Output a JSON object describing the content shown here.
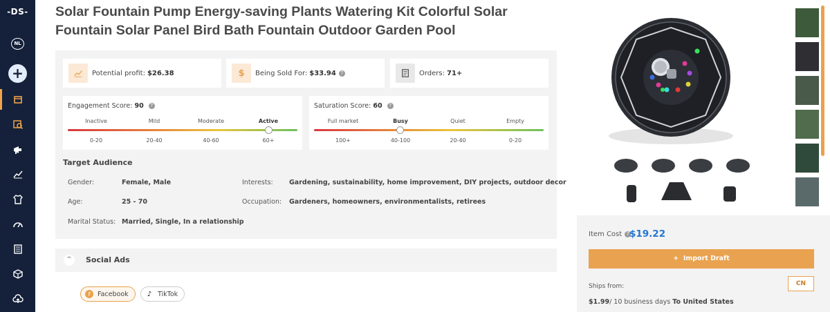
{
  "app": {
    "logo": "-DS-",
    "lang": "NL"
  },
  "sidebar": {
    "items": [
      {
        "name": "store-icon",
        "active": true
      },
      {
        "name": "product-search-icon",
        "active": false
      },
      {
        "name": "megaphone-icon",
        "active": false
      },
      {
        "name": "chart-icon",
        "active": false
      },
      {
        "name": "shirt-icon",
        "active": false
      },
      {
        "name": "gauge-icon",
        "active": false
      },
      {
        "name": "document-icon",
        "active": false
      },
      {
        "name": "box-icon",
        "active": false
      },
      {
        "name": "cloud-upload-icon",
        "active": false
      }
    ]
  },
  "product": {
    "title": "Solar Fountain Pump Energy-saving Plants Watering Kit Colorful Solar Fountain Solar Panel Bird Bath Fountain Outdoor Garden Pool"
  },
  "stats": {
    "profit_label": "Potential profit:",
    "profit_value": "$26.38",
    "sold_label": "Being Sold For:",
    "sold_value": "$33.94",
    "orders_label": "Orders:",
    "orders_value": "71+"
  },
  "engagement": {
    "label": "Engagement Score:",
    "value": "90",
    "levels": [
      "Inactive",
      "Mild",
      "Moderate",
      "Active"
    ],
    "ranges": [
      "0-20",
      "20-40",
      "40-60",
      "60+"
    ],
    "active_index": 3
  },
  "saturation": {
    "label": "Saturation Score:",
    "value": "60",
    "levels": [
      "Full market",
      "Busy",
      "Quiet",
      "Empty"
    ],
    "ranges": [
      "100+",
      "40-100",
      "20-40",
      "0-20"
    ],
    "active_index": 1
  },
  "audience": {
    "title": "Target Audience",
    "gender_label": "Gender:",
    "gender_value": "Female, Male",
    "age_label": "Age:",
    "age_value": "25 - 70",
    "marital_label": "Marital Status:",
    "marital_value": "Married, Single, In a relationship",
    "interests_label": "Interests:",
    "interests_value": "Gardening, sustainability, home improvement, DIY projects, outdoor decor",
    "occupation_label": "Occupation:",
    "occupation_value": "Gardeners, homeowners, environmentalists, retirees"
  },
  "social": {
    "label": "Social Ads",
    "facebook": "Facebook",
    "tiktok": "TikTok"
  },
  "purchase": {
    "cost_label": "Item Cost",
    "cost_value": "$19.22",
    "import_label": "Import Draft",
    "ships_from_label": "Ships from:",
    "origin": "CN",
    "ship_price": "$1.99",
    "ship_time": "/ 10 business days",
    "ship_to": "To United States"
  },
  "colors": {
    "accent": "#e9a24f",
    "sidebar": "#15213a",
    "price": "#2176d2"
  }
}
